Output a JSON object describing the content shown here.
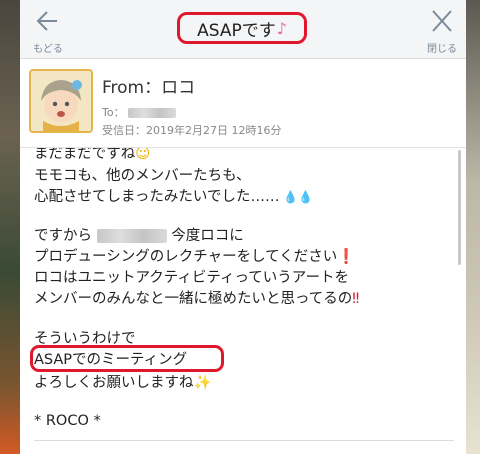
{
  "header": {
    "back_label": "もどる",
    "title": "ASAPです",
    "title_note": "♪",
    "close_label": "閉じる"
  },
  "mail": {
    "from": "From：ロコ",
    "to_label": "To：",
    "date": "受信日：2019年2月27日 12時16分"
  },
  "body": {
    "line1": "まだまだですね",
    "line2": "モモコも、他のメンバーたちも、",
    "line3": "心配させてしまったみたいでした……",
    "line4_pre": "ですから",
    "line4_post": "今度ロコに",
    "line5": "プロデューシングのレクチャーをしてください",
    "line6": "ロコはユニットアクティビティっていうアートを",
    "line7": "メンバーのみんなと一緒に極めたいと思ってるの",
    "line8": "そういうわけで",
    "line9": "ASAPでのミーティング",
    "line10": "よろしくお願いしますね",
    "signature": "* ROCO *"
  },
  "colors": {
    "highlight": "#e0182d",
    "accent": "#7b8a9a",
    "avatar_border": "#e6b54a"
  }
}
